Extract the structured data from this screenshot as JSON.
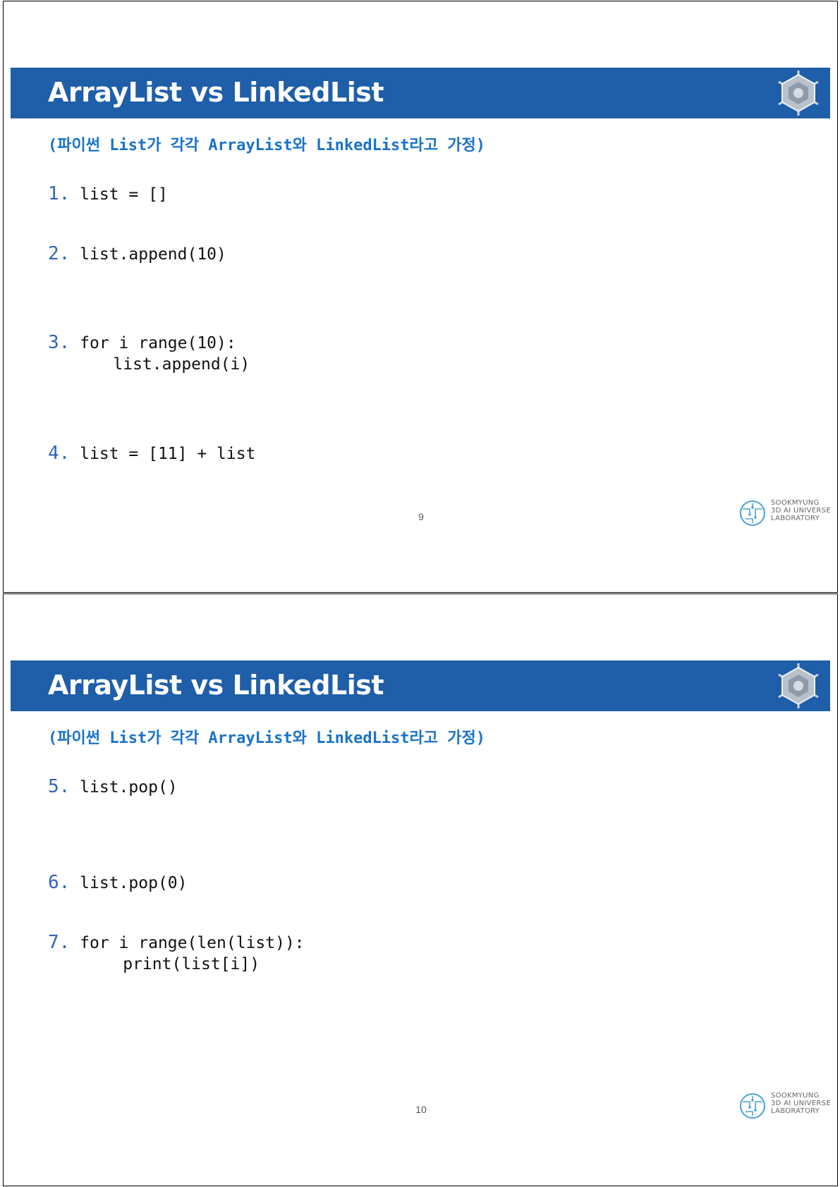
{
  "slides": [
    {
      "title": "ArrayList vs LinkedList",
      "subtitle": "(파이썬 List가 각각 ArrayList와 LinkedList라고 가정)",
      "items": [
        {
          "num": "1.",
          "lines": [
            "list = []"
          ]
        },
        {
          "num": "2.",
          "lines": [
            "list.append(10)"
          ]
        },
        {
          "num": "3.",
          "lines": [
            "for i range(10):",
            "    list.append(i)"
          ]
        },
        {
          "num": "4.",
          "lines": [
            "list = [11] + list"
          ]
        }
      ],
      "page_number": "9"
    },
    {
      "title": "ArrayList vs LinkedList",
      "subtitle": "(파이썬 List가 각각 ArrayList와 LinkedList라고 가정)",
      "items": [
        {
          "num": "5.",
          "lines": [
            "list.pop()"
          ]
        },
        {
          "num": "6.",
          "lines": [
            "list.pop(0)"
          ]
        },
        {
          "num": "7.",
          "lines": [
            "for i range(len(list)):",
            "     print(list[i])"
          ]
        }
      ],
      "page_number": "10"
    }
  ],
  "lab_logo_text": {
    "line1": "SOOKMYUNG",
    "line2": "3D AI UNIVERSE",
    "line3": "LABORATORY"
  },
  "colors": {
    "banner": "#1f5ea9",
    "subtitle": "#1a73c9",
    "number": "#2f65b8"
  },
  "icons": {
    "university_emblem": "snowflake-emblem-icon",
    "lab_logo": "circuit-globe-icon"
  }
}
